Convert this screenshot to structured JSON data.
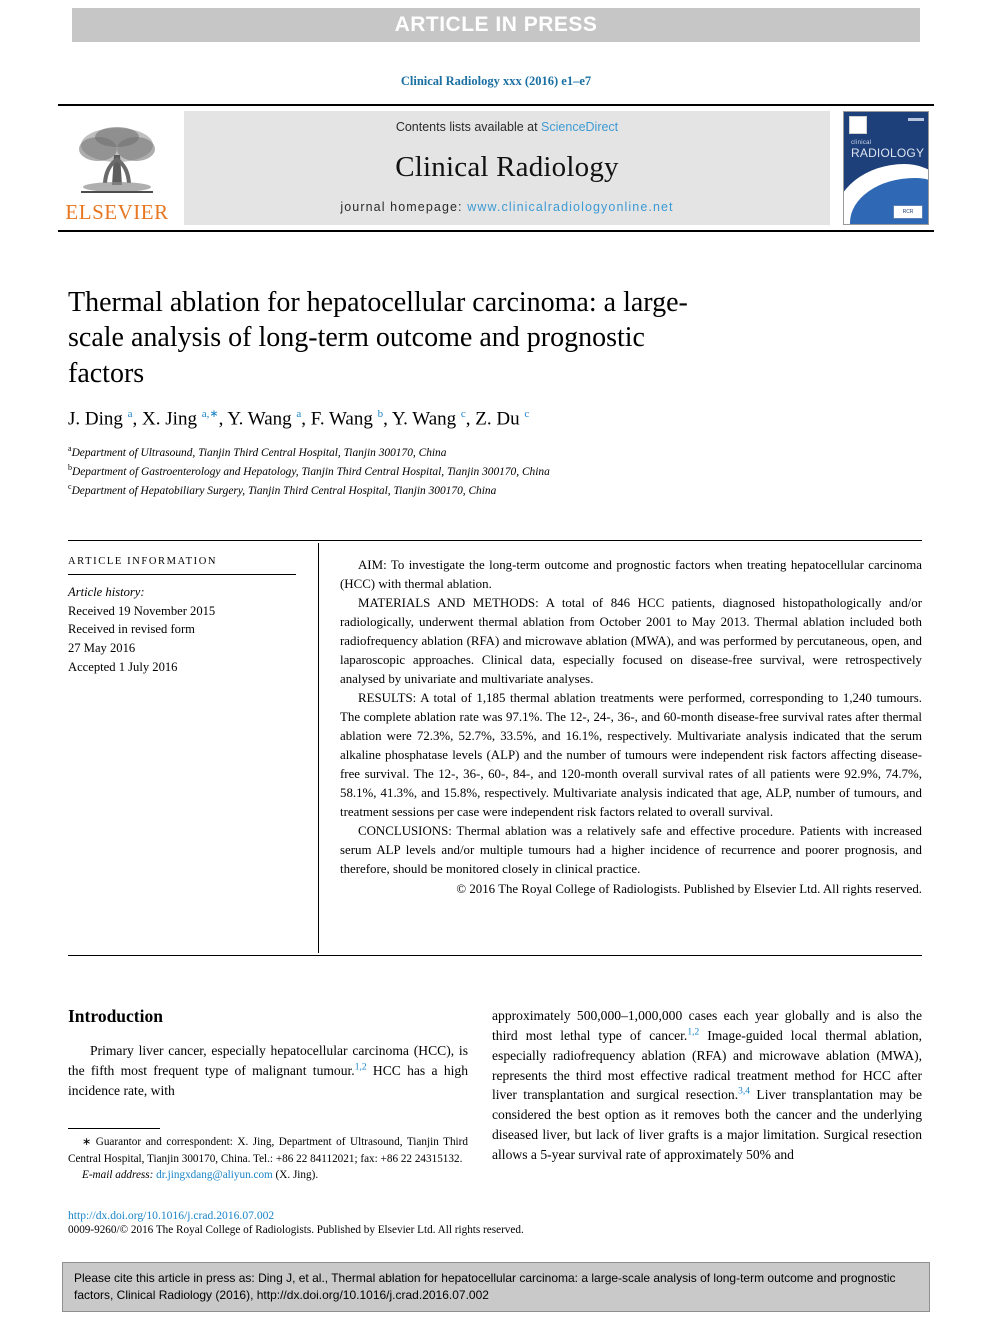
{
  "banner": {
    "label": "ARTICLE IN PRESS"
  },
  "running_head": "Clinical Radiology xxx (2016) e1–e7",
  "masthead": {
    "contents_prefix": "Contents lists available at ",
    "contents_link": "ScienceDirect",
    "journal_title": "Clinical Radiology",
    "homepage_prefix": "journal homepage: ",
    "homepage_url": "www.clinicalradiologyonline.net",
    "publisher_logo_text": "ELSEVIER",
    "cover": {
      "name_small": "clinical",
      "name_large": "RADIOLOGY",
      "badge": "RCR"
    },
    "colors": {
      "link": "#3e9ad4",
      "elsevier_orange": "#e87722",
      "cover_blue": "#1d3f7a",
      "panel_grey": "#e4e4e4"
    }
  },
  "article": {
    "title": "Thermal ablation for hepatocellular carcinoma: a large-scale analysis of long-term outcome and prognostic factors",
    "authors_html": "J. Ding <sup>a</sup>, X. Jing <sup>a,∗</sup>, Y. Wang <sup>a</sup>, F. Wang <sup>b</sup>, Y. Wang <sup>c</sup>, Z. Du <sup>c</sup>",
    "affiliations": [
      {
        "marker": "a",
        "text": "Department of Ultrasound, Tianjin Third Central Hospital, Tianjin 300170, China"
      },
      {
        "marker": "b",
        "text": "Department of Gastroenterology and Hepatology, Tianjin Third Central Hospital, Tianjin 300170, China"
      },
      {
        "marker": "c",
        "text": "Department of Hepatobiliary Surgery, Tianjin Third Central Hospital, Tianjin 300170, China"
      }
    ]
  },
  "article_information": {
    "heading": "ARTICLE INFORMATION",
    "history_label": "Article history:",
    "history_lines": [
      "Received 19 November 2015",
      "Received in revised form",
      "27 May 2016",
      "Accepted 1 July 2016"
    ]
  },
  "abstract": {
    "aim": "AIM: To investigate the long-term outcome and prognostic factors when treating hepatocellular carcinoma (HCC) with thermal ablation.",
    "materials_and_methods": "MATERIALS AND METHODS: A total of 846 HCC patients, diagnosed histopathologically and/or radiologically, underwent thermal ablation from October 2001 to May 2013. Thermal ablation included both radiofrequency ablation (RFA) and microwave ablation (MWA), and was performed by percutaneous, open, and laparoscopic approaches. Clinical data, especially focused on disease-free survival, were retrospectively analysed by univariate and multivariate analyses.",
    "results": "RESULTS: A total of 1,185 thermal ablation treatments were performed, corresponding to 1,240 tumours. The complete ablation rate was 97.1%. The 12-, 24-, 36-, and 60-month disease-free survival rates after thermal ablation were 72.3%, 52.7%, 33.5%, and 16.1%, respectively. Multivariate analysis indicated that the serum alkaline phosphatase levels (ALP) and the number of tumours were independent risk factors affecting disease-free survival. The 12-, 36-, 60-, 84-, and 120-month overall survival rates of all patients were 92.9%, 74.7%, 58.1%, 41.3%, and 15.8%, respectively. Multivariate analysis indicated that age, ALP, number of tumours, and treatment sessions per case were independent risk factors related to overall survival.",
    "conclusions": "CONCLUSIONS: Thermal ablation was a relatively safe and effective procedure. Patients with increased serum ALP levels and/or multiple tumours had a higher incidence of recurrence and poorer prognosis, and therefore, should be monitored closely in clinical practice.",
    "copyright": "© 2016 The Royal College of Radiologists. Published by Elsevier Ltd. All rights reserved."
  },
  "body": {
    "introduction_heading": "Introduction",
    "left_paragraph_html": "Primary liver cancer, especially hepatocellular carcinoma (HCC), is the fifth most frequent type of malignant tumour.<span class=\"ref\">1,2</span> HCC has a high incidence rate, with",
    "right_paragraph_html": "approximately 500,000–1,000,000 cases each year globally and is also the third most lethal type of cancer.<span class=\"ref\">1,2</span> Image-guided local thermal ablation, especially radiofrequency ablation (RFA) and microwave ablation (MWA), represents the third most effective radical treatment method for HCC after liver transplantation and surgical resection.<span class=\"ref\">3,4</span> Liver transplantation may be considered the best option as it removes both the cancer and the underlying diseased liver, but lack of liver grafts is a major limitation. Surgical resection allows a 5-year survival rate of approximately 50% and"
  },
  "footnotes": {
    "correspondence_html": "<span style=\"font-size:11px\">∗</span> Guarantor and correspondent: X. Jing, Department of Ultrasound, Tianjin Third Central Hospital, Tianjin 300170, China. Tel.: +86 22 84112021; fax: +86 22 24315132.",
    "email_label": "E-mail address:",
    "email_address": "dr.jingxdang@aliyun.com",
    "email_suffix": "(X. Jing)."
  },
  "doi_block": {
    "doi_url": "http://dx.doi.org/10.1016/j.crad.2016.07.002",
    "copyright_line": "0009-9260/© 2016 The Royal College of Radiologists. Published by Elsevier Ltd. All rights reserved."
  },
  "citation_box": {
    "text": "Please cite this article in press as: Ding J, et al., Thermal ablation for hepatocellular carcinoma: a large-scale analysis of long-term outcome and prognostic factors, Clinical Radiology (2016), http://dx.doi.org/10.1016/j.crad.2016.07.002"
  }
}
